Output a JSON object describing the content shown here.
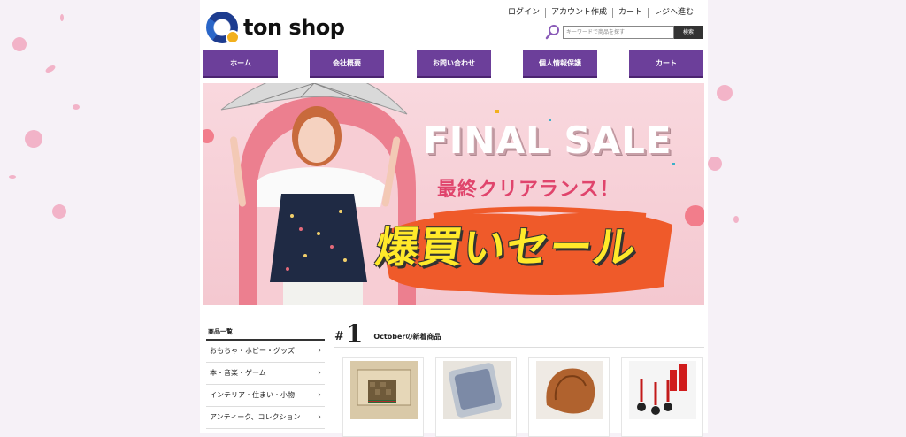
{
  "header": {
    "logo_text": "ton shop",
    "top_links": [
      "ログイン",
      "アカウント作成",
      "カート",
      "レジへ進む"
    ],
    "search": {
      "placeholder": "キーワードで商品を探す",
      "button": "検索"
    }
  },
  "nav": [
    "ホーム",
    "会社概要",
    "お問い合わせ",
    "個人情報保護",
    "カート"
  ],
  "banner": {
    "title": "FINAL SALE",
    "subtitle": "最終クリアランス！",
    "headline": "爆買いセール"
  },
  "sidebar": {
    "title": "商品一覧",
    "categories": [
      "おもちゃ・ホビー・グッズ",
      "本・音楽・ゲーム",
      "インテリア・住まい・小物",
      "アンティーク、コレクション"
    ]
  },
  "ranking": {
    "hash": "#",
    "number": "1",
    "title": "Octoberの新着商品"
  },
  "colors": {
    "nav": "#6c3f9a",
    "background": "#f6f1f7",
    "sale_pink": "#e0446c",
    "sale_yellow": "#ffe92a"
  }
}
